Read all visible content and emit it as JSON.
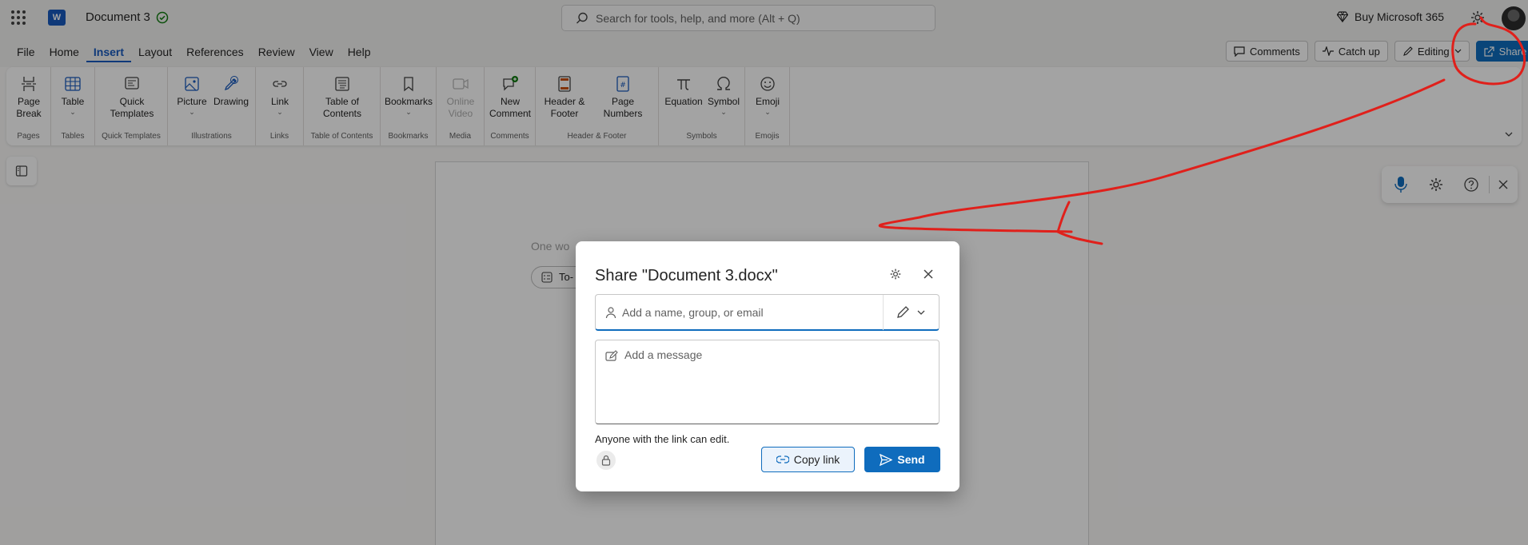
{
  "titlebar": {
    "doc_title": "Document 3",
    "search_placeholder": "Search for tools, help, and more (Alt + Q)",
    "buy_label": "Buy Microsoft 365",
    "word_logo": "W"
  },
  "menu": {
    "tabs": [
      "File",
      "Home",
      "Insert",
      "Layout",
      "References",
      "Review",
      "View",
      "Help"
    ],
    "active_tab": "Insert",
    "comments_label": "Comments",
    "catchup_label": "Catch up",
    "editing_label": "Editing",
    "share_label": "Share"
  },
  "ribbon": {
    "items": {
      "page_break": "Page Break",
      "table": "Table",
      "quick_templates": "Quick Templates",
      "picture": "Picture",
      "drawing": "Drawing",
      "link": "Link",
      "toc": "Table of Contents",
      "bookmarks": "Bookmarks",
      "online_video": "Online Video",
      "new_comment": "New Comment",
      "header_footer": "Header & Footer",
      "page_numbers": "Page Numbers",
      "equation": "Equation",
      "symbol": "Symbol",
      "emoji": "Emoji"
    },
    "groups": {
      "pages": "Pages",
      "tables": "Tables",
      "quick_templates": "Quick Templates",
      "illustrations": "Illustrations",
      "links": "Links",
      "toc": "Table of Contents",
      "bookmarks": "Bookmarks",
      "media": "Media",
      "comments": "Comments",
      "header_footer": "Header & Footer",
      "symbols": "Symbols",
      "emojis": "Emojis"
    }
  },
  "document": {
    "hint_text": "One wo",
    "todo_label": "To-"
  },
  "share_dialog": {
    "title": "Share \"Document 3.docx\"",
    "recipient_placeholder": "Add a name, group, or email",
    "message_placeholder": "Add a message",
    "link_info": "Anyone with the link can edit.",
    "copy_link_label": "Copy link",
    "send_label": "Send"
  },
  "colors": {
    "accent": "#0f6cbd",
    "word_brand": "#185abd",
    "annotation": "#e0201b"
  }
}
